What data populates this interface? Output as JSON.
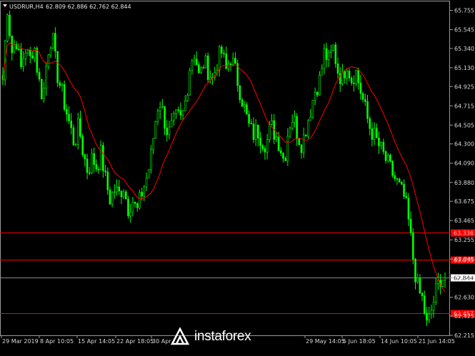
{
  "header": {
    "symbol": "USDRUR,H4",
    "ohlc": "62.809 62.886 62.762 62.844"
  },
  "watermark": {
    "text": "instaforex"
  },
  "colors": {
    "background": "#000000",
    "bull": "#00ff00",
    "bear": "#00ff00",
    "ma": "#ff0000",
    "hline": "#ff0000",
    "price_line": "#8a8a8a",
    "axis_text": "#d8d8d8"
  },
  "chart_data": {
    "type": "candlestick",
    "ylim": [
      62.215,
      65.86
    ],
    "yticks": [
      "65.755",
      "65.545",
      "65.340",
      "65.130",
      "64.925",
      "64.715",
      "64.505",
      "64.300",
      "64.090",
      "63.880",
      "63.675",
      "63.465",
      "63.255",
      "63.045",
      "62.840",
      "62.630",
      "62.425",
      "62.215"
    ],
    "xticks": [
      "29 Mar 2019",
      "8 Apr 10:05",
      "15 Apr 14:05",
      "22 Apr 18:05",
      "30 Apr",
      "29 May 14:05",
      "5 Jun 18:05",
      "14 Jun 10:05",
      "21 Jun 14:05"
    ],
    "horizontal_lines": [
      {
        "price": 63.336,
        "label": "63.336"
      },
      {
        "price": 63.035,
        "label": "63.035"
      },
      {
        "price": 62.457,
        "label": "62.457"
      }
    ],
    "current_price": {
      "price": 62.844,
      "label": "62.844"
    },
    "close_path": [
      65.0,
      65.8,
      65.3,
      65.45,
      65.1,
      65.35,
      65.2,
      65.4,
      65.0,
      64.8,
      65.3,
      65.5,
      65.1,
      64.9,
      64.7,
      64.5,
      64.3,
      64.5,
      64.2,
      64.0,
      64.15,
      64.05,
      64.2,
      63.9,
      63.7,
      63.8,
      63.75,
      63.85,
      63.6,
      63.7,
      63.55,
      63.75,
      63.9,
      64.1,
      64.5,
      64.8,
      64.6,
      64.4,
      64.5,
      64.6,
      64.55,
      64.8,
      65.2,
      65.3,
      65.0,
      65.2,
      65.1,
      65.0,
      65.2,
      65.3,
      65.1,
      65.25,
      65.1,
      64.9,
      64.7,
      64.5,
      64.4,
      64.45,
      64.35,
      64.3,
      64.5,
      64.4,
      64.3,
      64.1,
      64.5,
      64.6,
      64.4,
      64.3,
      64.5,
      64.7,
      64.9,
      65.0,
      65.3,
      65.2,
      65.35,
      65.1,
      65.0,
      65.2,
      65.0,
      65.1,
      64.9,
      64.7,
      64.5,
      64.4,
      64.3,
      64.2,
      64.1,
      64.0,
      63.9,
      63.8,
      63.7,
      63.4,
      63.0,
      62.7,
      62.6,
      62.3,
      62.5,
      62.7,
      62.85,
      62.844
    ],
    "ma_period": 12
  }
}
